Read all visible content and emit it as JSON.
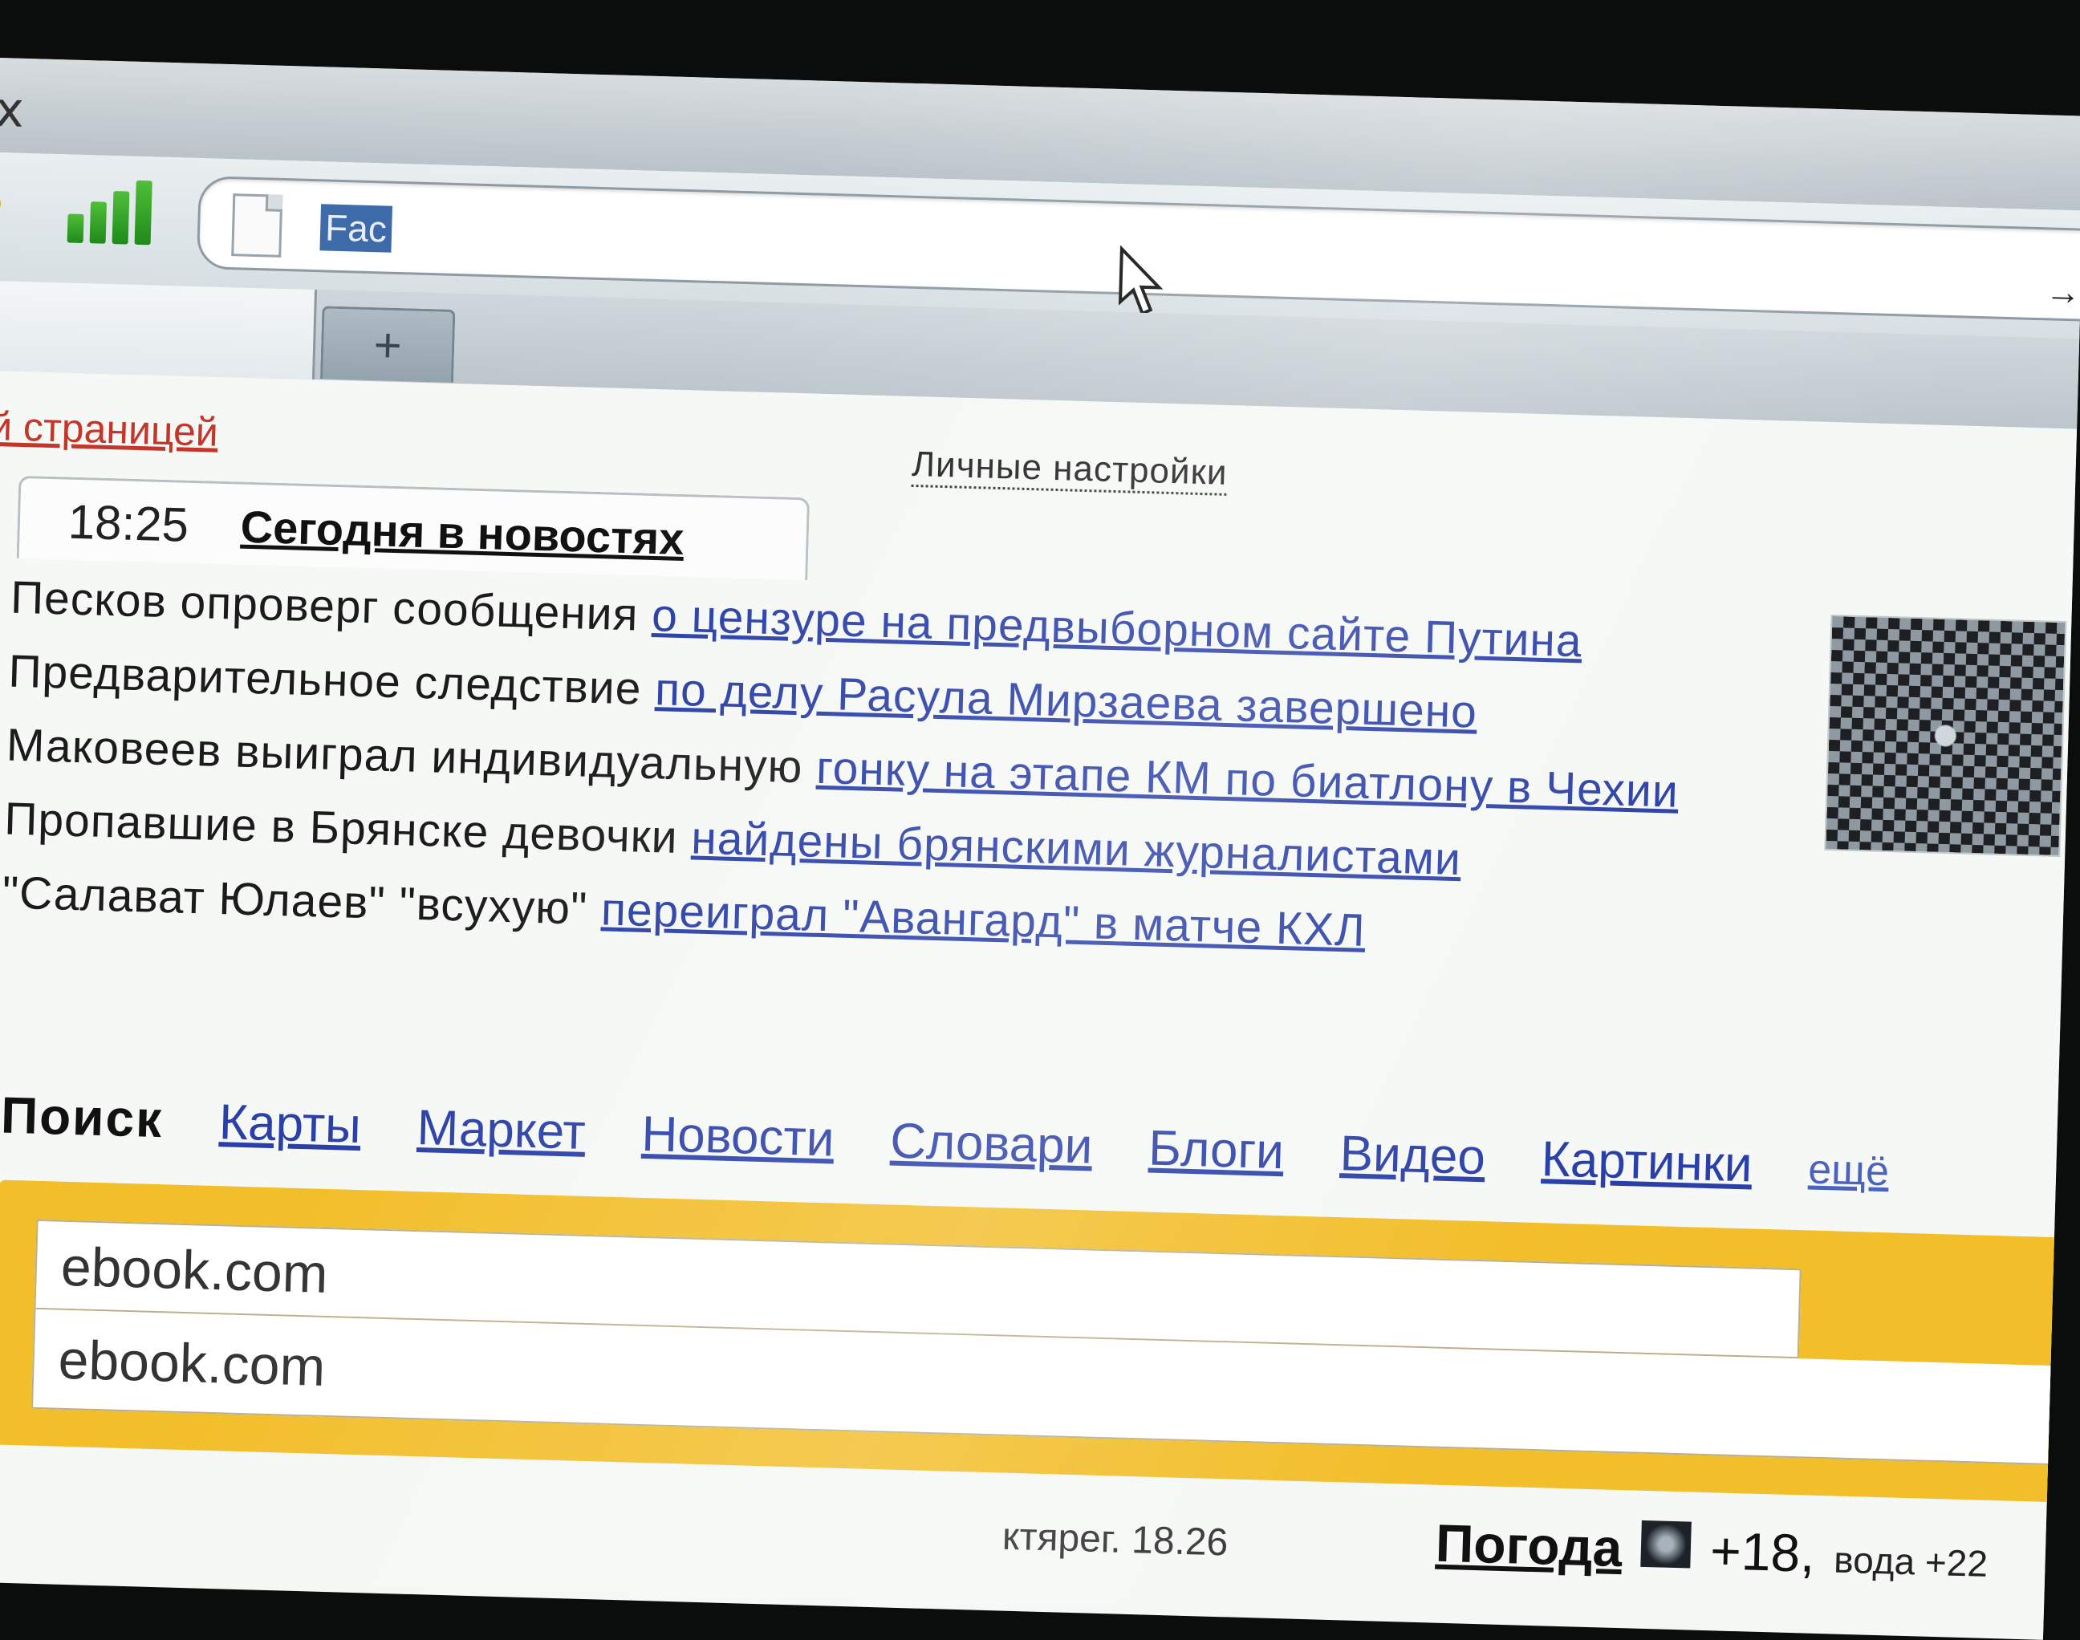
{
  "window": {
    "close_glyph": "x"
  },
  "addressbar": {
    "selected_text": "Fac"
  },
  "tabs": {
    "new_tab_glyph": "+"
  },
  "toolbar": {
    "forward_glyph": "→"
  },
  "header": {
    "home_link": "й страницей",
    "settings_link": "Личные настройки"
  },
  "news": {
    "time": "18:25",
    "title": "Сегодня в новостях",
    "items": [
      {
        "text": "Песков опроверг сообщения ",
        "link": "о цензуре на предвыборном сайте Путина"
      },
      {
        "text": "Предварительное следствие ",
        "link": "по делу Расула Мирзаева завершено"
      },
      {
        "text": "Маковеев выиграл индивидуальную ",
        "link": "гонку на этапе КМ по биатлону в Чехии"
      },
      {
        "text": "Пропавшие в Брянске девочки ",
        "link": "найдены брянскими журналистами"
      },
      {
        "text": "\"Салават Юлаев\" \"всухую\" ",
        "link": "переиграл \"Авангард\" в матче КХЛ"
      }
    ]
  },
  "services": {
    "brand": "Поиск",
    "items": [
      "Карты",
      "Маркет",
      "Новости",
      "Словари",
      "Блоги",
      "Видео",
      "Картинки"
    ],
    "more": "ещё"
  },
  "search": {
    "value": "ebook.com",
    "suggestion": "ebook.com"
  },
  "footer": {
    "time_fragment": "ктярег. 18.26"
  },
  "weather": {
    "label": "Погода",
    "temp": "+18,",
    "water": "вода +22"
  },
  "colors": {
    "link": "#2a3fa7",
    "search_frame": "#f2be2a",
    "home_link": "#c4352a"
  }
}
